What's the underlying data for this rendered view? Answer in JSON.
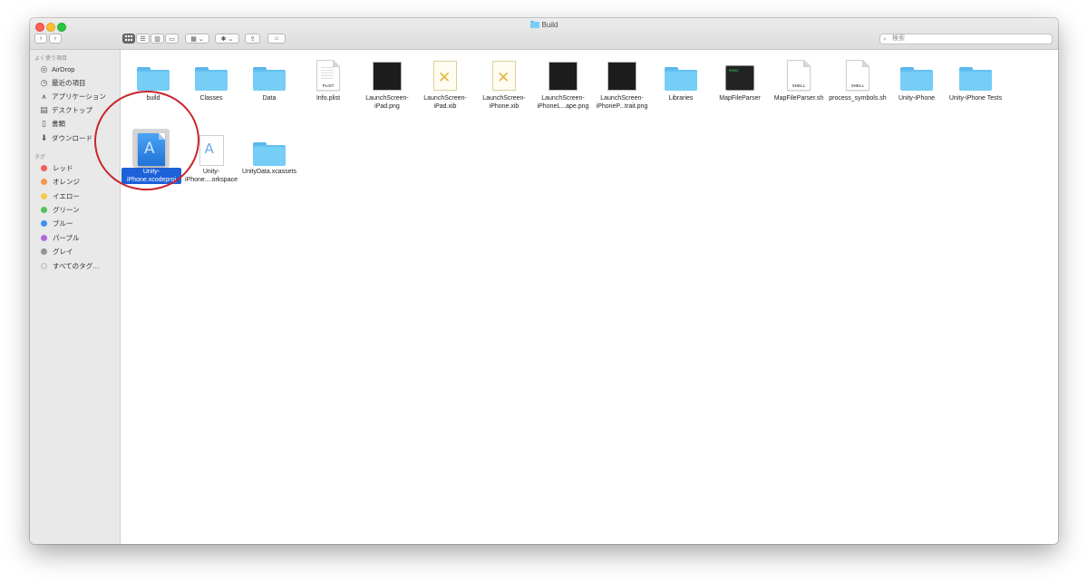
{
  "window": {
    "title": "Build",
    "accent": "#1d61d8"
  },
  "toolbar": {
    "back_icon": "chevron-left-icon",
    "forward_icon": "chevron-right-icon",
    "search_placeholder": "検索"
  },
  "sidebar": {
    "favorites_header": "よく使う項目",
    "favorites": [
      {
        "label": "AirDrop",
        "icon": "airdrop-icon"
      },
      {
        "label": "最近の項目",
        "icon": "recents-icon"
      },
      {
        "label": "アプリケーション",
        "icon": "applications-icon"
      },
      {
        "label": "デスクトップ",
        "icon": "desktop-icon"
      },
      {
        "label": "書類",
        "icon": "documents-icon"
      },
      {
        "label": "ダウンロード",
        "icon": "downloads-icon"
      }
    ],
    "tags_header": "タグ",
    "tags": [
      {
        "label": "レッド",
        "color": "#f55a5a"
      },
      {
        "label": "オレンジ",
        "color": "#f5984a"
      },
      {
        "label": "イエロー",
        "color": "#f5c94a"
      },
      {
        "label": "グリーン",
        "color": "#53c15b"
      },
      {
        "label": "ブルー",
        "color": "#3d8ff5"
      },
      {
        "label": "パープル",
        "color": "#b26ad9"
      },
      {
        "label": "グレイ",
        "color": "#959595"
      },
      {
        "label": "すべてのタグ…",
        "color": "#e3e3e3"
      }
    ]
  },
  "files": [
    {
      "name": "build",
      "kind": "folder"
    },
    {
      "name": "Classes",
      "kind": "folder"
    },
    {
      "name": "Data",
      "kind": "folder"
    },
    {
      "name": "Info.plist",
      "kind": "plist",
      "badge": "PLIST"
    },
    {
      "name": "LaunchScreen-iPad.png",
      "kind": "png"
    },
    {
      "name": "LaunchScreen-iPad.xib",
      "kind": "xib"
    },
    {
      "name": "LaunchScreen-iPhone.xib",
      "kind": "xib"
    },
    {
      "name": "LaunchScreen-iPhoneL...ape.png",
      "kind": "png"
    },
    {
      "name": "LaunchScreen-iPhoneP...trait.png",
      "kind": "png"
    },
    {
      "name": "Libraries",
      "kind": "folder"
    },
    {
      "name": "MapFileParser",
      "kind": "exec",
      "badge": "exec"
    },
    {
      "name": "MapFileParser.sh",
      "kind": "shell",
      "badge": "SHELL"
    },
    {
      "name": "process_symbols.sh",
      "kind": "shell",
      "badge": "SHELL"
    },
    {
      "name": "Unity-iPhone",
      "kind": "folder"
    },
    {
      "name": "Unity-iPhone Tests",
      "kind": "folder"
    },
    {
      "name": "Unity-iPhone.xcodeproj",
      "kind": "xcodeproj",
      "selected": true
    },
    {
      "name": "Unity-iPhone....orkspace",
      "kind": "xcworkspace"
    },
    {
      "name": "UnityData.xcassets",
      "kind": "folder"
    }
  ]
}
